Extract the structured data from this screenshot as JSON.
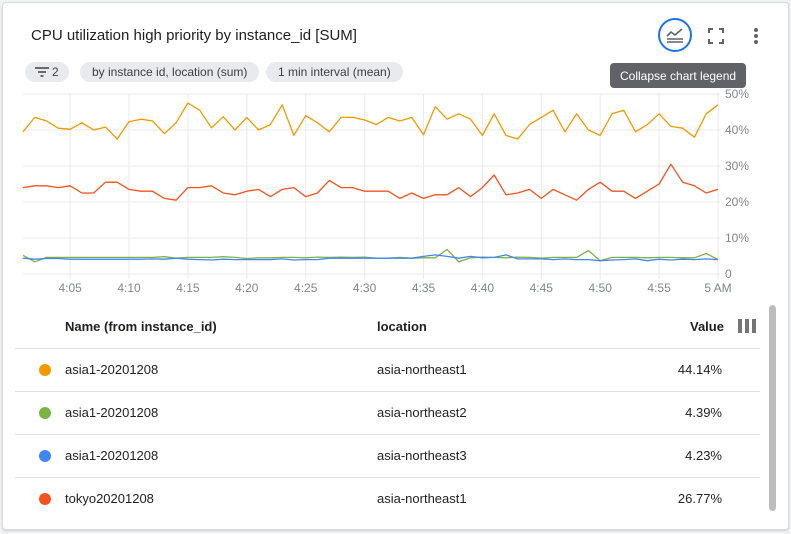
{
  "title": "CPU utilization high priority by instance_id [SUM]",
  "toolbar": {
    "legend_icon": "legend-collapse-icon",
    "fullscreen_icon": "fullscreen-icon",
    "more_icon": "more-vert-icon",
    "tooltip": "Collapse chart legend",
    "accent_color": "#1a73e8"
  },
  "chips": [
    {
      "label": "2",
      "icon": "filter-icon"
    },
    {
      "label": "by instance id, location (sum)"
    },
    {
      "label": "1 min interval (mean)"
    }
  ],
  "chart_data": {
    "type": "line",
    "x": [
      "4:01",
      "4:02",
      "4:03",
      "4:04",
      "4:05",
      "4:06",
      "4:07",
      "4:08",
      "4:09",
      "4:10",
      "4:11",
      "4:12",
      "4:13",
      "4:14",
      "4:15",
      "4:16",
      "4:17",
      "4:18",
      "4:19",
      "4:20",
      "4:21",
      "4:22",
      "4:23",
      "4:24",
      "4:25",
      "4:26",
      "4:27",
      "4:28",
      "4:29",
      "4:30",
      "4:31",
      "4:32",
      "4:33",
      "4:34",
      "4:35",
      "4:36",
      "4:37",
      "4:38",
      "4:39",
      "4:40",
      "4:41",
      "4:42",
      "4:43",
      "4:44",
      "4:45",
      "4:46",
      "4:47",
      "4:48",
      "4:49",
      "4:50",
      "4:51",
      "4:52",
      "4:53",
      "4:54",
      "4:55",
      "4:56",
      "4:57",
      "4:58",
      "4:59",
      "5:00"
    ],
    "x_ticks": [
      "4:05",
      "4:10",
      "4:15",
      "4:20",
      "4:25",
      "4:30",
      "4:35",
      "4:40",
      "4:45",
      "4:50",
      "4:55",
      "5 AM"
    ],
    "y_ticks": [
      "0",
      "10%",
      "20%",
      "30%",
      "40%",
      "50%"
    ],
    "ylim": [
      0,
      50
    ],
    "grid": true,
    "y_axis_position": "right",
    "series": [
      {
        "name": "asia1-20201208",
        "color": "#f29900",
        "values": [
          39.5,
          43.5,
          42.5,
          40.5,
          40.2,
          42,
          40,
          40.8,
          37.5,
          42.3,
          43,
          42.5,
          39,
          42,
          47.5,
          45.5,
          40.6,
          43.7,
          40,
          43.5,
          40,
          41.5,
          47,
          38.5,
          44,
          42,
          39.5,
          43.5,
          43.5,
          42.8,
          41.5,
          43.5,
          42.5,
          43.5,
          38.7,
          46.5,
          43,
          44.5,
          43,
          38.5,
          44.5,
          38.5,
          37.5,
          41.5,
          43.5,
          45.5,
          39.5,
          44.5,
          40,
          38.5,
          44.5,
          45.5,
          39.5,
          41.5,
          44.5,
          41,
          40.5,
          38,
          44.5,
          47
        ]
      },
      {
        "name": "asia1-20201208",
        "color": "#7cb342",
        "values": [
          5.2,
          3.4,
          4.6,
          4.6,
          4.6,
          4.6,
          4.6,
          4.6,
          4.6,
          4.6,
          4.6,
          4.6,
          4.8,
          4.4,
          4.6,
          4.6,
          4.6,
          4.8,
          4.6,
          4.3,
          4.5,
          4.5,
          4.6,
          4.6,
          4.5,
          4.7,
          4.6,
          4.7,
          4.6,
          4.7,
          4.4,
          4.4,
          4.6,
          4.4,
          4.5,
          4.5,
          6.8,
          3.4,
          4.5,
          4.7,
          4.6,
          4.5,
          4.7,
          4.6,
          4.4,
          4.6,
          4.6,
          4.6,
          6.5,
          3.7,
          4.6,
          4.6,
          4.6,
          4.5,
          4.6,
          4.6,
          4.5,
          4.5,
          5.7,
          4.0
        ]
      },
      {
        "name": "asia1-20201208",
        "color": "#4285f4",
        "values": [
          4.4,
          4.1,
          4.3,
          4.3,
          4.1,
          4.1,
          4.1,
          4.1,
          4.1,
          4.1,
          4.1,
          4.2,
          4.1,
          4.4,
          4.1,
          4.0,
          3.9,
          4.1,
          4.0,
          4.0,
          4.0,
          4.0,
          4.2,
          3.9,
          4.0,
          4.0,
          4.4,
          4.4,
          4.4,
          4.4,
          4.4,
          4.4,
          4.4,
          4.4,
          4.9,
          5.3,
          4.9,
          4.4,
          4.9,
          4.5,
          4.6,
          5.3,
          4.2,
          4.2,
          4.2,
          4.0,
          4.2,
          4.0,
          4.0,
          3.7,
          3.9,
          4.0,
          4.2,
          3.7,
          4.1,
          3.9,
          4.1,
          4.0,
          4.2,
          4.0
        ]
      },
      {
        "name": "tokyo20201208",
        "color": "#f4511e",
        "values": [
          24,
          24.5,
          24.5,
          24,
          24.5,
          22.5,
          22.5,
          25.5,
          25.5,
          23.5,
          23,
          23,
          21,
          20.5,
          24,
          24,
          24.5,
          22.5,
          22,
          23,
          23.5,
          21.5,
          23.5,
          24,
          21.5,
          22.5,
          26,
          24,
          24,
          23,
          23,
          23,
          21,
          22.5,
          21,
          22,
          22,
          24,
          21.5,
          24,
          27.5,
          22,
          22.5,
          23.5,
          21,
          23.5,
          22,
          20.5,
          23.5,
          25.5,
          23,
          23,
          21,
          23,
          25,
          30.5,
          25.5,
          24.5,
          22.5,
          23.5
        ]
      }
    ]
  },
  "table": {
    "headers": {
      "name": "Name (from instance_id)",
      "location": "location",
      "value": "Value"
    },
    "columns_icon": "column-picker-icon",
    "rows": [
      {
        "color": "#f29900",
        "name": "asia1-20201208",
        "location": "asia-northeast1",
        "value": "44.14%"
      },
      {
        "color": "#7cb342",
        "name": "asia1-20201208",
        "location": "asia-northeast2",
        "value": "4.39%"
      },
      {
        "color": "#4285f4",
        "name": "asia1-20201208",
        "location": "asia-northeast3",
        "value": "4.23%"
      },
      {
        "color": "#f4511e",
        "name": "tokyo20201208",
        "location": "asia-northeast1",
        "value": "26.77%"
      }
    ]
  }
}
